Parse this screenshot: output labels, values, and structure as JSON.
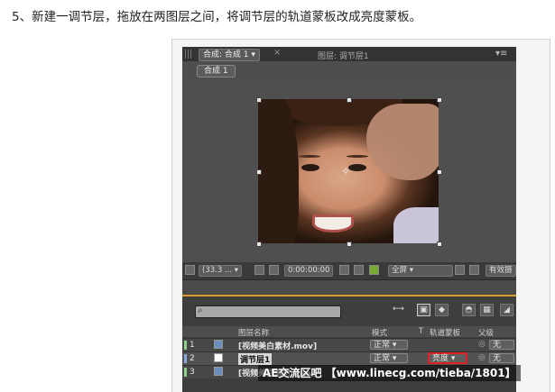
{
  "caption": "5、新建一调节层，拖放在两图层之间，将调节层的轨道蒙板改成亮度蒙板。",
  "ae": {
    "tab_comp": "合成: 合成 1 ▾",
    "tab_close": "×",
    "tab_layer": "图层: 调节层1",
    "panel_menu": "▾≡",
    "breadcrumb": "合成 1",
    "viewer": {
      "zoom": "(33.3 ... ▾",
      "timecode": "0:00:00:00",
      "resolution": "全屏 ▾",
      "view": "有效摄"
    },
    "timeline": {
      "columns": {
        "name": "图层名称",
        "mode": "模式",
        "t": "T",
        "trkmat": "轨道蒙板",
        "parent": "父级"
      },
      "layers": [
        {
          "num": "1",
          "name": "[视频美白素材.mov]",
          "mode": "正常 ▾",
          "trkmat": "",
          "parent": "无",
          "label_color": "#8fd18f"
        },
        {
          "num": "2",
          "name": "调节层1",
          "mode": "正常 ▾",
          "trkmat": "亮度 ▾",
          "parent": "无",
          "label_color": "#8aa8e0"
        },
        {
          "num": "3",
          "name": "[视频美白素材.mov]",
          "mode": "",
          "trkmat": "",
          "parent": "",
          "label_color": "#8fd18f"
        }
      ]
    }
  },
  "watermark": "AE交流区吧 【www.linecg.com/tieba/1801】"
}
